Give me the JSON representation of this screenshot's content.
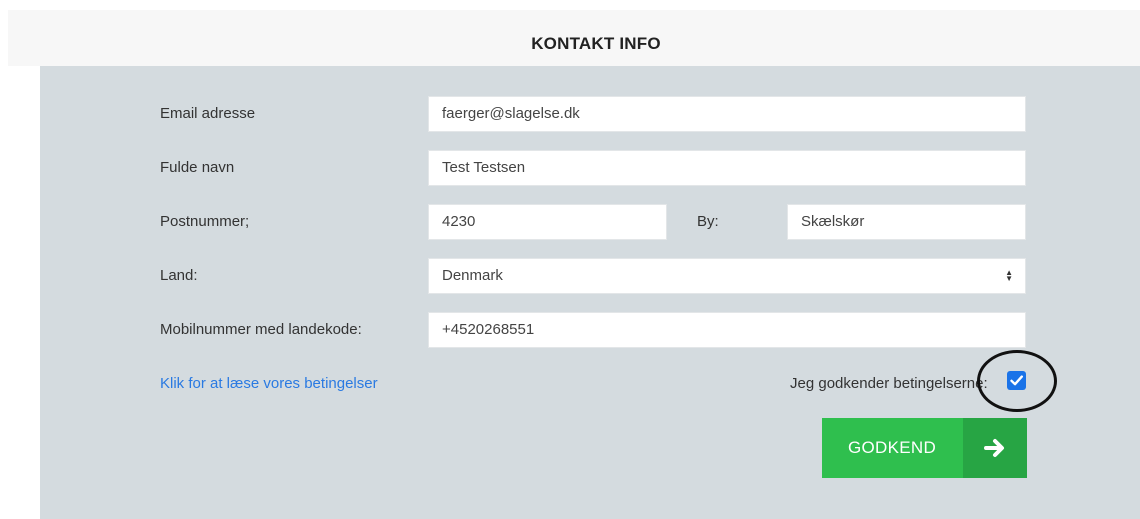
{
  "header": {
    "title": "KONTAKT INFO"
  },
  "form": {
    "email": {
      "label": "Email adresse",
      "value": "faerger@slagelse.dk"
    },
    "fullname": {
      "label": "Fulde navn",
      "value": "Test Testsen"
    },
    "postal": {
      "label": "Postnummer;",
      "value": "4230"
    },
    "city": {
      "label": "By:",
      "value": "Skælskør"
    },
    "country": {
      "label": "Land:",
      "value": "Denmark"
    },
    "mobile": {
      "label": "Mobilnummer med landekode:",
      "value": "+4520268551"
    },
    "terms_link": "Klik for at læse vores betingelser",
    "accept_label": "Jeg godkender betingelserne:",
    "accept_checked": true,
    "submit_label": "GODKEND"
  },
  "icons": {
    "select_arrow": "select-updown-icon",
    "submit_arrow": "arrow-right-icon",
    "checkbox": "checkmark-icon"
  },
  "colors": {
    "panel": "#d4dbdf",
    "submit": "#2fbf4e",
    "submit_dark": "#27a544",
    "link": "#2a7ae2",
    "checkbox": "#1a73e8"
  }
}
